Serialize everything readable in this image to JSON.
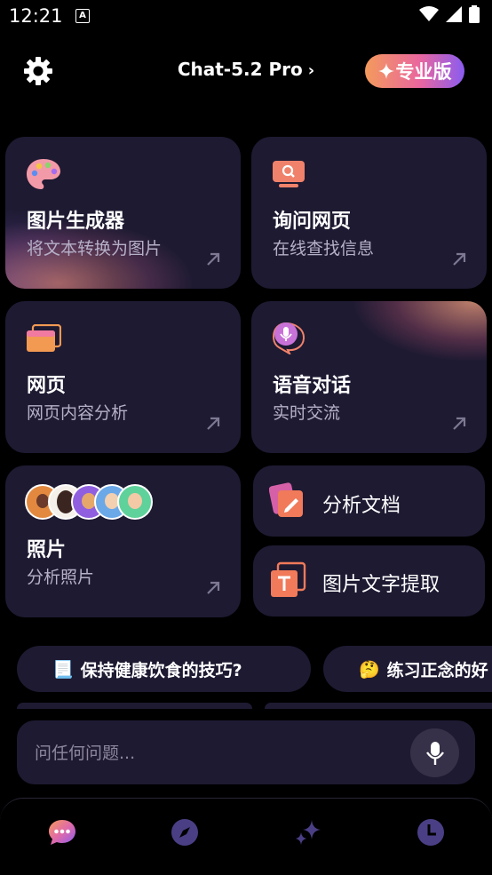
{
  "status_bar": {
    "time": "12:21",
    "notif_letter": "A"
  },
  "header": {
    "title": "Chat-5.2 Pro",
    "pro_label": "专业版"
  },
  "cards": {
    "image_gen": {
      "title": "图片生成器",
      "subtitle": "将文本转换为图片"
    },
    "ask_web": {
      "title": "询问网页",
      "subtitle": "在线查找信息"
    },
    "webpage": {
      "title": "网页",
      "subtitle": "网页内容分析"
    },
    "voice": {
      "title": "语音对话",
      "subtitle": "实时交流"
    },
    "photos": {
      "title": "照片",
      "subtitle": "分析照片"
    },
    "analyze_doc": {
      "label": "分析文档"
    },
    "ocr": {
      "label": "图片文字提取"
    }
  },
  "suggestions": [
    {
      "emoji": "📃",
      "text": "保持健康饮食的技巧?"
    },
    {
      "emoji": "🤔",
      "text": "练习正念的好"
    }
  ],
  "input": {
    "placeholder": "问任何问题..."
  },
  "nav": [
    "chat-icon",
    "compass-icon",
    "sparkles-icon",
    "history-icon"
  ],
  "colors": {
    "card_bg": "#1e1a32",
    "accent_purple": "#8a5cf0",
    "accent_orange": "#f49a5b"
  }
}
